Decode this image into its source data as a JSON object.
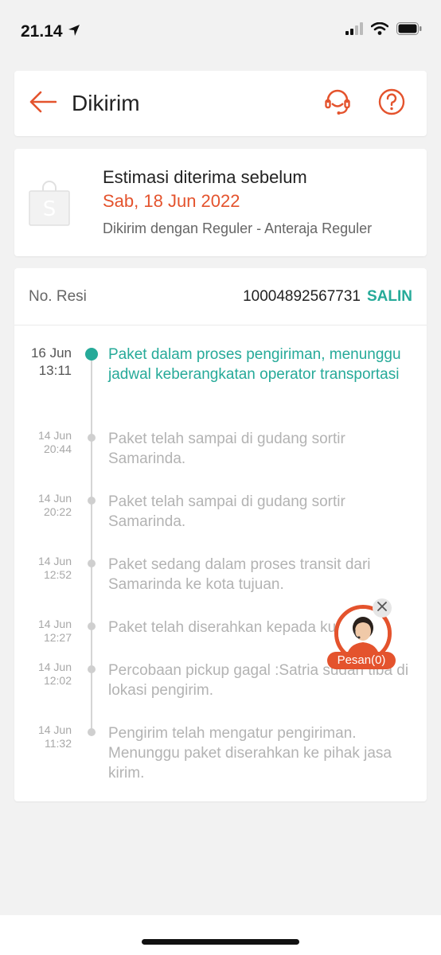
{
  "status_bar": {
    "time": "21.14",
    "icons": [
      "location-arrow-icon",
      "signal-icon",
      "wifi-icon",
      "battery-icon"
    ]
  },
  "header": {
    "title": "Dikirim",
    "icons": [
      "back-arrow-icon",
      "customer-service-icon",
      "help-icon"
    ]
  },
  "estimate": {
    "label": "Estimasi diterima sebelum",
    "date": "Sab, 18 Jun 2022",
    "courier": "Dikirim dengan Reguler - Anteraja Reguler",
    "icon": "shopee-bag-icon"
  },
  "tracking": {
    "resi_label": "No. Resi",
    "resi_number": "10004892567731",
    "copy_label": "SALIN",
    "events": [
      {
        "date": "16 Jun",
        "time": "13:11",
        "text": "Paket dalam proses pengiriman, menunggu jadwal keberangkatan operator transportasi",
        "active": true
      },
      {
        "date": "14 Jun",
        "time": "20:44",
        "text": "Paket telah sampai di gudang sortir Samarinda.",
        "active": false
      },
      {
        "date": "14 Jun",
        "time": "20:22",
        "text": "Paket telah sampai di gudang sortir Samarinda.",
        "active": false
      },
      {
        "date": "14 Jun",
        "time": "12:52",
        "text": "Paket sedang dalam proses transit dari Samarinda ke kota tujuan.",
        "active": false
      },
      {
        "date": "14 Jun",
        "time": "12:27",
        "text": "Paket telah diserahkan kepada kurir",
        "active": false
      },
      {
        "date": "14 Jun",
        "time": "12:02",
        "text": "Percobaan pickup gagal :Satria sudah tiba di lokasi pengirim.",
        "active": false
      },
      {
        "date": "14 Jun",
        "time": "11:32",
        "text": "Pengirim telah mengatur pengiriman. Menunggu paket diserahkan ke pihak jasa kirim.",
        "active": false
      }
    ]
  },
  "chat": {
    "label": "Pesan(0)",
    "icon": "agent-avatar-icon"
  },
  "colors": {
    "accent": "#e4532d",
    "teal": "#26aa99",
    "background": "#f2f2f2"
  }
}
